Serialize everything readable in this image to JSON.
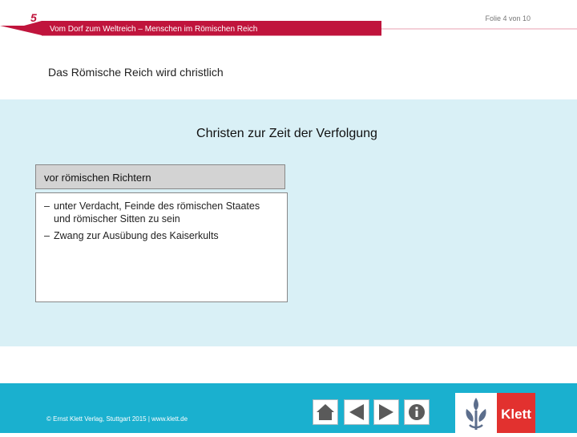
{
  "header": {
    "chapter_number": "5",
    "slide_counter": "Folie 4 von 10",
    "title": "Vom Dorf zum Weltreich – Menschen im Römischen Reich"
  },
  "subtitle": "Das Römische Reich wird christlich",
  "panel": {
    "title": "Christen zur Zeit der Verfolgung",
    "box_header": "vor römischen Richtern",
    "items": [
      {
        "dash": "–",
        "text": "unter Verdacht, Feinde des römischen Staates und römischer Sitten zu sein"
      },
      {
        "dash": "–",
        "text": "Zwang zur Ausübung des Kaiserkults"
      }
    ]
  },
  "footer": {
    "copyright": "© Ernst Klett Verlag, Stuttgart 2015 | www.klett.de",
    "nav_icons": [
      "home-icon",
      "back-arrow-icon",
      "forward-arrow-icon",
      "info-icon"
    ],
    "logo_text": "Klett"
  },
  "colors": {
    "accent_red": "#c0143c",
    "panel_bg": "#d9f0f6",
    "footer_bg": "#1ab0cf",
    "klett_red": "#e2312f"
  }
}
